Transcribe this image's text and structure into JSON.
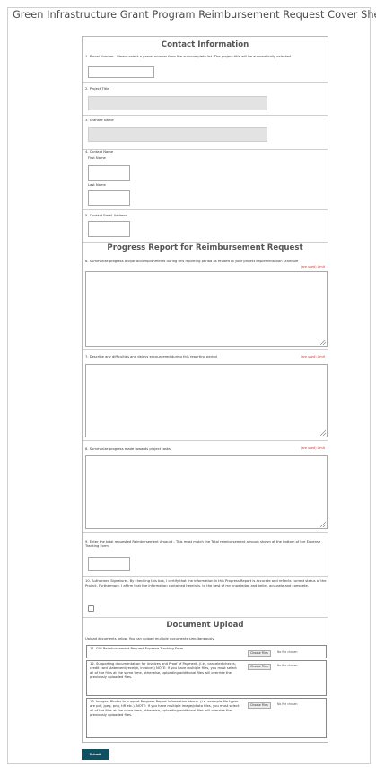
{
  "page": {
    "title": "Green Infrastructure Grant Program Reimbursement Request Cover Sheet"
  },
  "contact": {
    "header": "Contact Information",
    "parcel_label": "1. Parcel Number - Please select a parcel number from the autocomplete list. The project title will be automatically selected.",
    "parcel_value": "",
    "project_title_label": "2. Project Title",
    "project_title_value": "",
    "grantee_label": "3. Grantee Name",
    "grantee_value": "",
    "contact_name_label": "4. Contact Name",
    "first_name_label": "First Name",
    "first_name_value": "",
    "last_name_label": "Last Name",
    "last_name_value": "",
    "email_label": "5. Contact Email Address",
    "email_value": ""
  },
  "progress": {
    "header": "Progress Report for Reimbursement Request",
    "q6_label": "6. Summarize progress and/or accomplishments during this reporting period as related to your project implementation schedule",
    "q6_req": "(are used) Limit",
    "q7_label": "7. Describe any difficulties and delays encountered during this reporting period",
    "q7_req": "(are used) Limit",
    "q8_label": "8. Summarize progress made towards project tasks",
    "q8_req": "(are used) Limit",
    "q9_label": "9. Enter the total requested Reimbursement Amount - This must match the Total reimbursement amount shown at the bottom of the Expense Tracking Form.",
    "q9_value": "",
    "q10_label": "10. Authorized Signature - By checking this box, I certify that the information in this Progress Report is accurate and reflects current status of the Project. Furthermore, I affirm that the information contained herein is, to the best of my knowledge and belief, accurate and complete."
  },
  "upload": {
    "header": "Document Upload",
    "intro": "Upload documents below. You can upload multiple documents simultaneously.",
    "item11": "11. GIG Reimbursement Request Expense Tracking Form",
    "item12": "12. Supporting documentation for invoices and Proof of Payment. (i.e., canceled checks, credit card statement/receipt, invoices) NOTE: If you have multiple files, you must select all of the files at the same time, otherwise, uploading additional files will override the previously uploaded files.",
    "item13": "13. Images: Photos to support Progress Report information above. (i.e. example file types are pdf, jpeg, png, tiff etc.). NOTE: If you have multiple image/photo files, you must select all of the files at the same time, otherwise, uploading additional files will override the previously uploaded files.",
    "choose_label": "Choose Files",
    "no_file_label": "No file chosen"
  },
  "submit_label": "Submit"
}
